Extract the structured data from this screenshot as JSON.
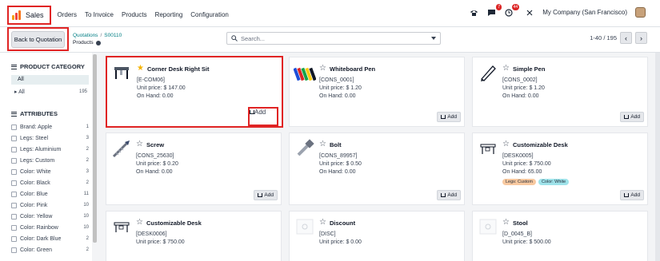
{
  "navbar": {
    "app_name": "Sales",
    "menu": [
      "Orders",
      "To Invoice",
      "Products",
      "Reporting",
      "Configuration"
    ],
    "chat_badge": "7",
    "activity_badge": "44",
    "company": "My Company (San Francisco)"
  },
  "control": {
    "back_label": "Back to Quotation",
    "breadcrumb_parent": "Quotations",
    "breadcrumb_record": "S00110",
    "breadcrumb_current": "Products",
    "search_placeholder": "Search...",
    "pager": "1-40 / 195"
  },
  "sidebar": {
    "category_title": "PRODUCT CATEGORY",
    "category_selected": "All",
    "category_all": "All",
    "category_all_count": "195",
    "attributes_title": "ATTRIBUTES",
    "attributes": [
      {
        "label": "Brand: Apple",
        "count": "1"
      },
      {
        "label": "Legs: Steel",
        "count": "3"
      },
      {
        "label": "Legs: Aluminium",
        "count": "2"
      },
      {
        "label": "Legs: Custom",
        "count": "2"
      },
      {
        "label": "Color: White",
        "count": "3"
      },
      {
        "label": "Color: Black",
        "count": "2"
      },
      {
        "label": "Color: Blue",
        "count": "11"
      },
      {
        "label": "Color: Pink",
        "count": "10"
      },
      {
        "label": "Color: Yellow",
        "count": "10"
      },
      {
        "label": "Color: Rainbow",
        "count": "10"
      },
      {
        "label": "Color: Dark Blue",
        "count": "2"
      },
      {
        "label": "Color: Green",
        "count": "2"
      }
    ]
  },
  "add_label": "Add",
  "products": [
    {
      "name": "Corner Desk Right Sit",
      "ref": "[E-COM06]",
      "price": "Unit price: $ 147.00",
      "onhand": "On Hand: 0.00",
      "fav": true
    },
    {
      "name": "Whiteboard Pen",
      "ref": "[CONS_0001]",
      "price": "Unit price: $ 1.20",
      "onhand": "On Hand: 0.00"
    },
    {
      "name": "Simple Pen",
      "ref": "[CONS_0002]",
      "price": "Unit price: $ 1.20",
      "onhand": "On Hand: 0.00"
    },
    {
      "name": "Screw",
      "ref": "[CONS_25630]",
      "price": "Unit price: $ 0.20",
      "onhand": "On Hand: 0.00"
    },
    {
      "name": "Bolt",
      "ref": "[CONS_89957]",
      "price": "Unit price: $ 0.50",
      "onhand": "On Hand: 0.00"
    },
    {
      "name": "Customizable Desk",
      "ref": "[DESK0005]",
      "price": "Unit price: $ 750.00",
      "onhand": "On Hand: 65.00",
      "tags": [
        "Legs: Custom",
        "Color: White"
      ]
    },
    {
      "name": "Customizable Desk",
      "ref": "[DESK0006]",
      "price": "Unit price: $ 750.00"
    },
    {
      "name": "Discount",
      "ref": "[DISC]",
      "price": "Unit price: $ 0.00"
    },
    {
      "name": "Stool",
      "ref": "[D_0045_B]",
      "price": "Unit price: $ 500.00"
    }
  ],
  "colors": {
    "highlight": "#e02424",
    "teal": "#017e84",
    "tag_orange": "#f8c9a0",
    "tag_cyan": "#9fe3ea"
  }
}
